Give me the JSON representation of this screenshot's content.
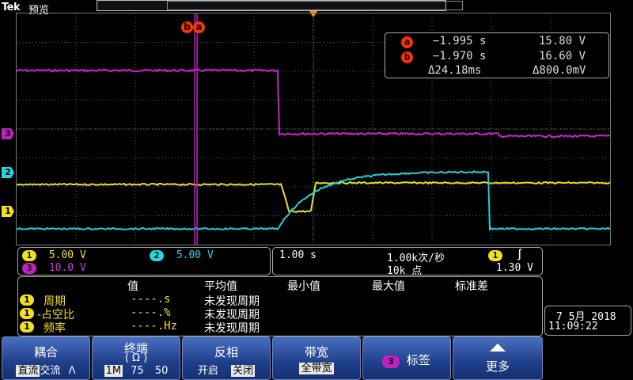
{
  "header": {
    "brand": "Tek",
    "mode": "预览"
  },
  "channels": [
    {
      "id": "1",
      "scale": "5.00 V",
      "color": "#f0e020"
    },
    {
      "id": "2",
      "scale": "5.00 V",
      "color": "#20d8e0"
    },
    {
      "id": "3",
      "scale": "10.0 V",
      "color": "#c020c0"
    }
  ],
  "cursor_labels": {
    "a": "a",
    "b": "b"
  },
  "cursors": {
    "a": {
      "time": "−1.995 s",
      "value": "15.80 V"
    },
    "b": {
      "time": "−1.970 s",
      "value": "16.60 V"
    },
    "delta_time": "Δ24.18ms",
    "delta_value": "Δ800.0mV"
  },
  "timebase": {
    "scale": "1.00 s",
    "sample_rate": "1.00k次/秒",
    "record_length": "10k 点",
    "trigger_channel": "1",
    "trigger_level": "1.30 V"
  },
  "measurements": {
    "headers": [
      "值",
      "平均值",
      "最小值",
      "最大值",
      "标准差"
    ],
    "rows": [
      {
        "channel": "1",
        "name": "周期",
        "value": "----.s",
        "status": "未发现周期"
      },
      {
        "channel": "1",
        "name": "-占空比",
        "value": "----.%",
        "status": "未发现周期"
      },
      {
        "channel": "1",
        "name": "频率",
        "value": "----.Hz",
        "status": "未发现周期"
      }
    ]
  },
  "datetime": {
    "date": "7 5月 2018",
    "time": "11:09:22"
  },
  "softkeys": {
    "coupling": {
      "title": "耦合",
      "options": [
        "直流",
        "交流",
        "ⴷ"
      ]
    },
    "termination": {
      "title": "终端",
      "subtitle": "( Ω )",
      "options": [
        "1M",
        "75",
        "50"
      ]
    },
    "invert": {
      "title": "反相",
      "options": [
        "开启",
        "关闭"
      ]
    },
    "bandwidth": {
      "title": "带宽",
      "selected": "全带宽"
    },
    "label": {
      "channel": "3",
      "title": "标签"
    },
    "more": {
      "title": "更多"
    }
  }
}
